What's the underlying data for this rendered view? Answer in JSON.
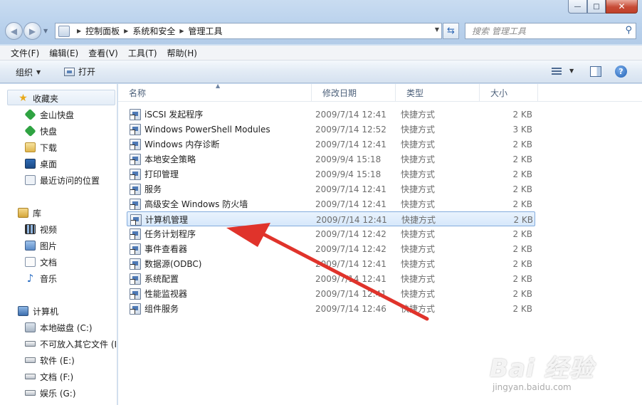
{
  "window": {
    "minimize_label": "—",
    "maximize_label": "□",
    "close_label": "✕"
  },
  "nav": {
    "back_icon": "back-arrow-icon",
    "forward_icon": "forward-arrow-icon"
  },
  "address": {
    "breadcrumbs": [
      "控制面板",
      "系统和安全",
      "管理工具"
    ]
  },
  "search": {
    "placeholder": "搜索 管理工具"
  },
  "menu": [
    "文件(F)",
    "编辑(E)",
    "查看(V)",
    "工具(T)",
    "帮助(H)"
  ],
  "toolbar": {
    "organize_label": "组织",
    "open_label": "打开"
  },
  "sidebar": {
    "favorites": {
      "label": "收藏夹",
      "items": [
        "金山快盘",
        "快盘",
        "下载",
        "桌面",
        "最近访问的位置"
      ]
    },
    "libraries": {
      "label": "库",
      "items": [
        "视频",
        "图片",
        "文档",
        "音乐"
      ]
    },
    "computer": {
      "label": "计算机",
      "items": [
        "本地磁盘 (C:)",
        "不可放入其它文件 (I",
        "软件 (E:)",
        "文档 (F:)",
        "娱乐 (G:)"
      ]
    }
  },
  "columns": {
    "name": "名称",
    "date": "修改日期",
    "type": "类型",
    "size": "大小"
  },
  "files": [
    {
      "name": "iSCSI 发起程序",
      "date": "2009/7/14 12:41",
      "type": "快捷方式",
      "size": "2 KB"
    },
    {
      "name": "Windows PowerShell Modules",
      "date": "2009/7/14 12:52",
      "type": "快捷方式",
      "size": "3 KB"
    },
    {
      "name": "Windows 内存诊断",
      "date": "2009/7/14 12:41",
      "type": "快捷方式",
      "size": "2 KB"
    },
    {
      "name": "本地安全策略",
      "date": "2009/9/4 15:18",
      "type": "快捷方式",
      "size": "2 KB"
    },
    {
      "name": "打印管理",
      "date": "2009/9/4 15:18",
      "type": "快捷方式",
      "size": "2 KB"
    },
    {
      "name": "服务",
      "date": "2009/7/14 12:41",
      "type": "快捷方式",
      "size": "2 KB"
    },
    {
      "name": "高级安全 Windows 防火墙",
      "date": "2009/7/14 12:41",
      "type": "快捷方式",
      "size": "2 KB"
    },
    {
      "name": "计算机管理",
      "date": "2009/7/14 12:41",
      "type": "快捷方式",
      "size": "2 KB"
    },
    {
      "name": "任务计划程序",
      "date": "2009/7/14 12:42",
      "type": "快捷方式",
      "size": "2 KB"
    },
    {
      "name": "事件查看器",
      "date": "2009/7/14 12:42",
      "type": "快捷方式",
      "size": "2 KB"
    },
    {
      "name": "数据源(ODBC)",
      "date": "2009/7/14 12:41",
      "type": "快捷方式",
      "size": "2 KB"
    },
    {
      "name": "系统配置",
      "date": "2009/7/14 12:41",
      "type": "快捷方式",
      "size": "2 KB"
    },
    {
      "name": "性能监视器",
      "date": "2009/7/14 12:41",
      "type": "快捷方式",
      "size": "2 KB"
    },
    {
      "name": "组件服务",
      "date": "2009/7/14 12:46",
      "type": "快捷方式",
      "size": "2 KB"
    }
  ],
  "selected_file": "计算机管理",
  "watermark": {
    "text": "Bai 经验",
    "url": "jingyan.baidu.com"
  },
  "colors": {
    "annotation_arrow": "#e0332b",
    "selection": "#d7e8fb"
  }
}
